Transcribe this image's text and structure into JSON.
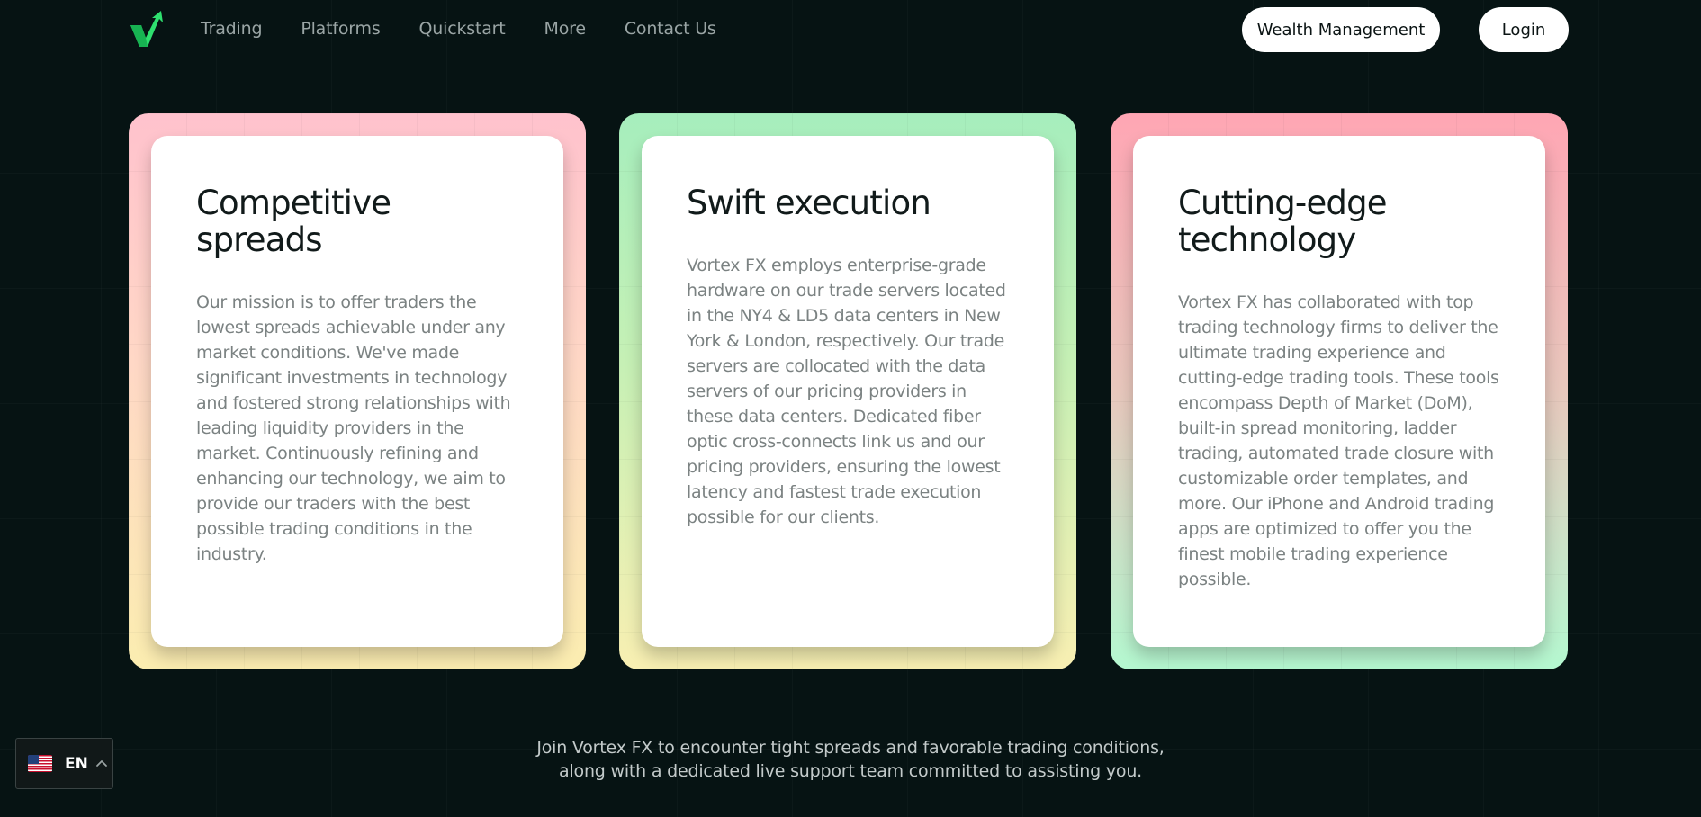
{
  "nav": {
    "links": [
      "Trading",
      "Platforms",
      "Quickstart",
      "More",
      "Contact Us"
    ],
    "wealth_label": "Wealth Management",
    "login_label": "Login"
  },
  "cards": [
    {
      "title": "Competitive spreads",
      "text": "Our mission is to offer traders the lowest spreads achievable under any market conditions. We've made significant investments in technology and fostered strong relationships with leading liquidity providers in the market. Continuously refining and enhancing our technology, we aim to provide our traders with the best possible trading conditions in the industry."
    },
    {
      "title": "Swift execution",
      "text": "Vortex FX employs enterprise-grade hardware on our trade servers located in the NY4 & LD5 data centers in New York & London, respectively. Our trade servers are collocated with the data servers of our pricing providers in these data centers. Dedicated fiber optic cross-connects link us and our pricing providers, ensuring the lowest latency and fastest trade execution possible for our clients."
    },
    {
      "title": "Cutting-edge technology",
      "text": "Vortex FX has collaborated with top trading technology firms to deliver the ultimate trading experience and cutting-edge trading tools. These tools encompass Depth of Market (DoM), built-in spread monitoring, ladder trading, automated trade closure with customizable order templates, and more. Our iPhone and Android trading apps are optimized to offer you the finest mobile trading experience possible."
    }
  ],
  "footer": {
    "line1": "Join Vortex FX to encounter tight spreads and favorable trading conditions,",
    "line2": "along with a dedicated live support team committed to assisting you."
  },
  "language": {
    "code": "EN",
    "flag_icon": "us-flag-icon"
  },
  "colors": {
    "background": "#061313",
    "accent_green": "#2ee06f"
  }
}
